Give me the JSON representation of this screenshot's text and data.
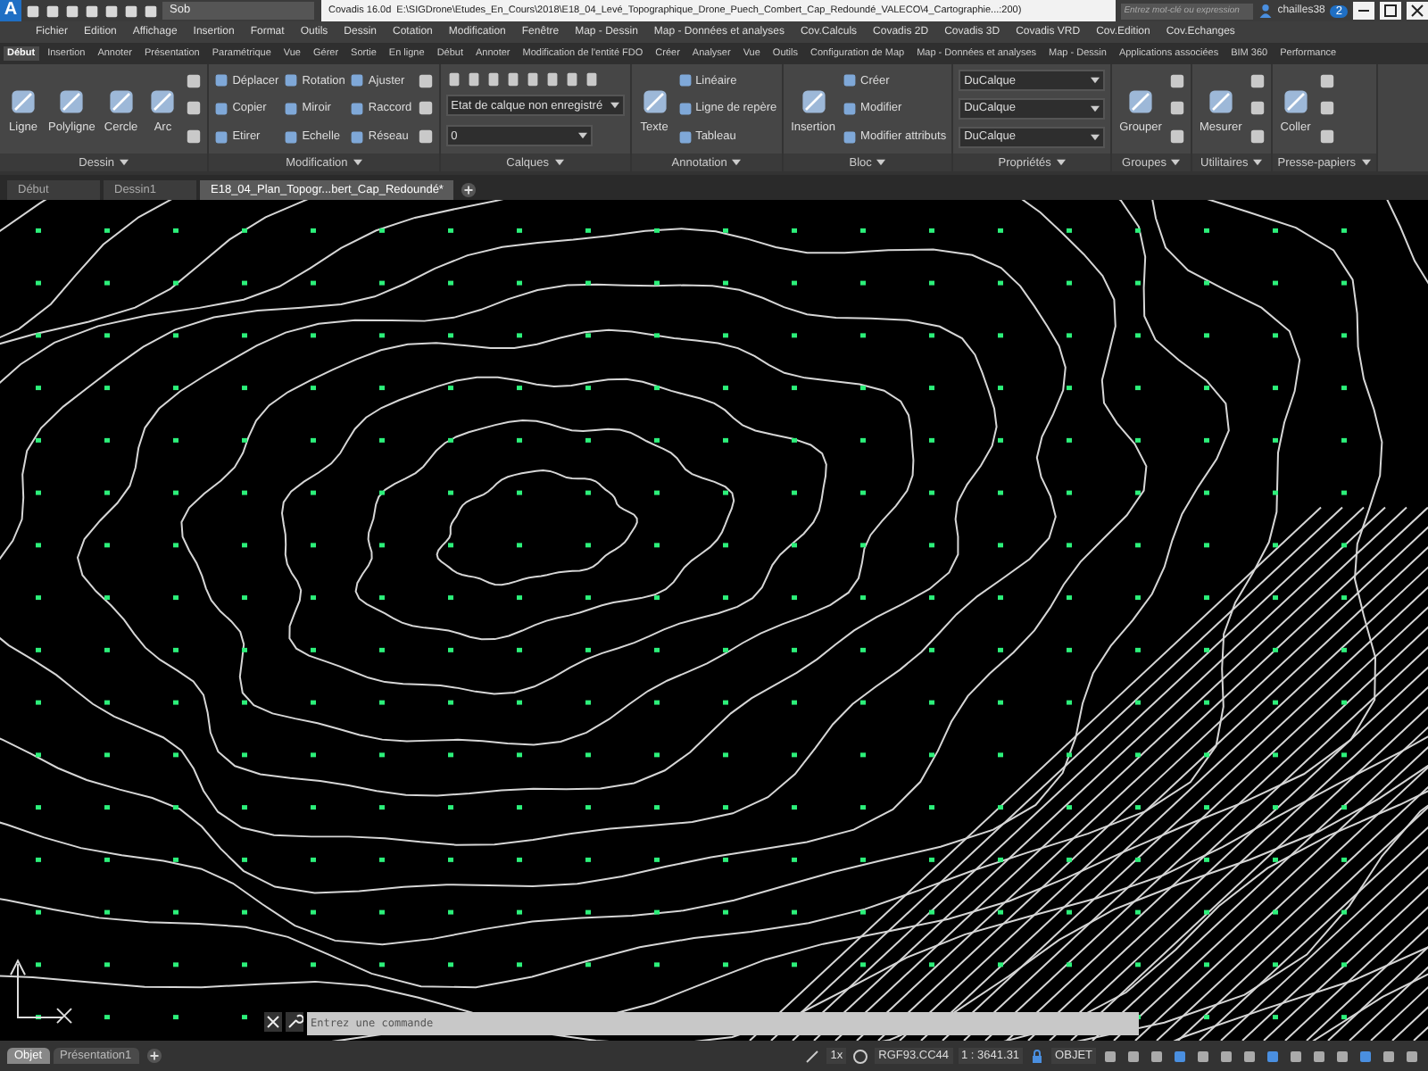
{
  "title_bar": {
    "logo": "A",
    "workspace": "Sob",
    "app": "Covadis 16.0d",
    "path": "E:\\SIGDrone\\Etudes_En_Cours\\2018\\E18_04_Levé_Topographique_Drone_Puech_Combert_Cap_Redoundé_VALECO\\4_Cartographie...:200)",
    "search_placeholder": "Entrez mot-clé ou expression",
    "user": "chailles38",
    "notification_count": "2"
  },
  "menu_bar": [
    "Fichier",
    "Edition",
    "Affichage",
    "Insertion",
    "Format",
    "Outils",
    "Dessin",
    "Cotation",
    "Modification",
    "Fenêtre",
    "Map - Dessin",
    "Map - Données et analyses",
    "Cov.Calculs",
    "Covadis 2D",
    "Covadis 3D",
    "Covadis VRD",
    "Cov.Edition",
    "Cov.Echanges"
  ],
  "ribbon_tabs": [
    {
      "label": "Début",
      "selected": true
    },
    {
      "label": "Insertion",
      "selected": false
    },
    {
      "label": "Annoter",
      "selected": false
    },
    {
      "label": "Présentation",
      "selected": false
    },
    {
      "label": "Paramétrique",
      "selected": false
    },
    {
      "label": "Vue",
      "selected": false
    },
    {
      "label": "Gérer",
      "selected": false
    },
    {
      "label": "Sortie",
      "selected": false
    },
    {
      "label": "En ligne",
      "selected": false
    },
    {
      "label": "Début",
      "selected": false
    },
    {
      "label": "Annoter",
      "selected": false
    },
    {
      "label": "Modification de l'entité FDO",
      "selected": false
    },
    {
      "label": "Créer",
      "selected": false
    },
    {
      "label": "Analyser",
      "selected": false
    },
    {
      "label": "Vue",
      "selected": false
    },
    {
      "label": "Outils",
      "selected": false
    },
    {
      "label": "Configuration de Map",
      "selected": false
    },
    {
      "label": "Map - Données et analyses",
      "selected": false
    },
    {
      "label": "Map - Dessin",
      "selected": false
    },
    {
      "label": "Applications associées",
      "selected": false
    },
    {
      "label": "BIM 360",
      "selected": false
    },
    {
      "label": "Performance",
      "selected": false
    }
  ],
  "ribbon_panels": [
    {
      "title": "Dessin",
      "columns": [
        [
          {
            "kind": "large",
            "label": "Ligne"
          }
        ],
        [
          {
            "kind": "large",
            "label": "Polyligne"
          }
        ],
        [
          {
            "kind": "large",
            "label": "Cercle"
          }
        ],
        [
          {
            "kind": "large",
            "label": "Arc"
          }
        ],
        [
          {
            "kind": "icon"
          },
          {
            "kind": "icon"
          },
          {
            "kind": "icon"
          }
        ]
      ]
    },
    {
      "title": "Modification",
      "columns": [
        [
          {
            "kind": "small",
            "label": "Déplacer"
          },
          {
            "kind": "small",
            "label": "Copier"
          },
          {
            "kind": "small",
            "label": "Etirer"
          }
        ],
        [
          {
            "kind": "small",
            "label": "Rotation"
          },
          {
            "kind": "small",
            "label": "Miroir"
          },
          {
            "kind": "small",
            "label": "Echelle"
          }
        ],
        [
          {
            "kind": "small",
            "label": "Ajuster"
          },
          {
            "kind": "small",
            "label": "Raccord"
          },
          {
            "kind": "small",
            "label": "Réseau"
          }
        ],
        [
          {
            "kind": "icon"
          },
          {
            "kind": "icon"
          },
          {
            "kind": "icon"
          }
        ]
      ]
    },
    {
      "title": "Calques",
      "columns": [
        [
          {
            "kind": "icon_row"
          },
          {
            "kind": "dropdown",
            "label": "Etat de calque non enregistré"
          },
          {
            "kind": "dropdown",
            "label": "0"
          }
        ]
      ]
    },
    {
      "title": "Annotation",
      "columns": [
        [
          {
            "kind": "large",
            "label": "Texte"
          }
        ],
        [
          {
            "kind": "small",
            "label": "Linéaire"
          },
          {
            "kind": "small",
            "label": "Ligne de repère"
          },
          {
            "kind": "small",
            "label": "Tableau"
          }
        ]
      ]
    },
    {
      "title": "Bloc",
      "columns": [
        [
          {
            "kind": "large",
            "label": "Insertion"
          }
        ],
        [
          {
            "kind": "small",
            "label": "Créer"
          },
          {
            "kind": "small",
            "label": "Modifier"
          },
          {
            "kind": "small",
            "label": "Modifier attributs"
          }
        ]
      ]
    },
    {
      "title": "Propriétés",
      "columns": [
        [
          {
            "kind": "dropdown",
            "label": "DuCalque"
          },
          {
            "kind": "dropdown",
            "label": "DuCalque"
          },
          {
            "kind": "dropdown",
            "label": "DuCalque"
          }
        ]
      ]
    },
    {
      "title": "Groupes",
      "columns": [
        [
          {
            "kind": "large",
            "label": "Grouper"
          }
        ],
        [
          {
            "kind": "icon"
          },
          {
            "kind": "icon"
          },
          {
            "kind": "icon"
          }
        ]
      ]
    },
    {
      "title": "Utilitaires",
      "columns": [
        [
          {
            "kind": "large",
            "label": "Mesurer"
          }
        ],
        [
          {
            "kind": "icon"
          },
          {
            "kind": "icon"
          },
          {
            "kind": "icon"
          }
        ]
      ]
    },
    {
      "title": "Presse-papiers",
      "columns": [
        [
          {
            "kind": "large",
            "label": "Coller"
          }
        ],
        [
          {
            "kind": "icon"
          },
          {
            "kind": "icon"
          },
          {
            "kind": "icon"
          }
        ]
      ]
    }
  ],
  "file_tabs": [
    {
      "label": "Début",
      "selected": false
    },
    {
      "label": "Dessin1",
      "selected": false
    },
    {
      "label": "E18_04_Plan_Topogr...bert_Cap_Redoundé*",
      "selected": true
    }
  ],
  "command_line": {
    "placeholder": "Entrez une commande"
  },
  "layout_tabs": [
    {
      "label": "Objet",
      "selected": true
    },
    {
      "label": "Présentation1",
      "selected": false
    }
  ],
  "status_bar": {
    "annotation_scale": "1x",
    "coordinate_system": "RGF93.CC44",
    "scale": "1 : 3641.31",
    "mode": "OBJET"
  }
}
